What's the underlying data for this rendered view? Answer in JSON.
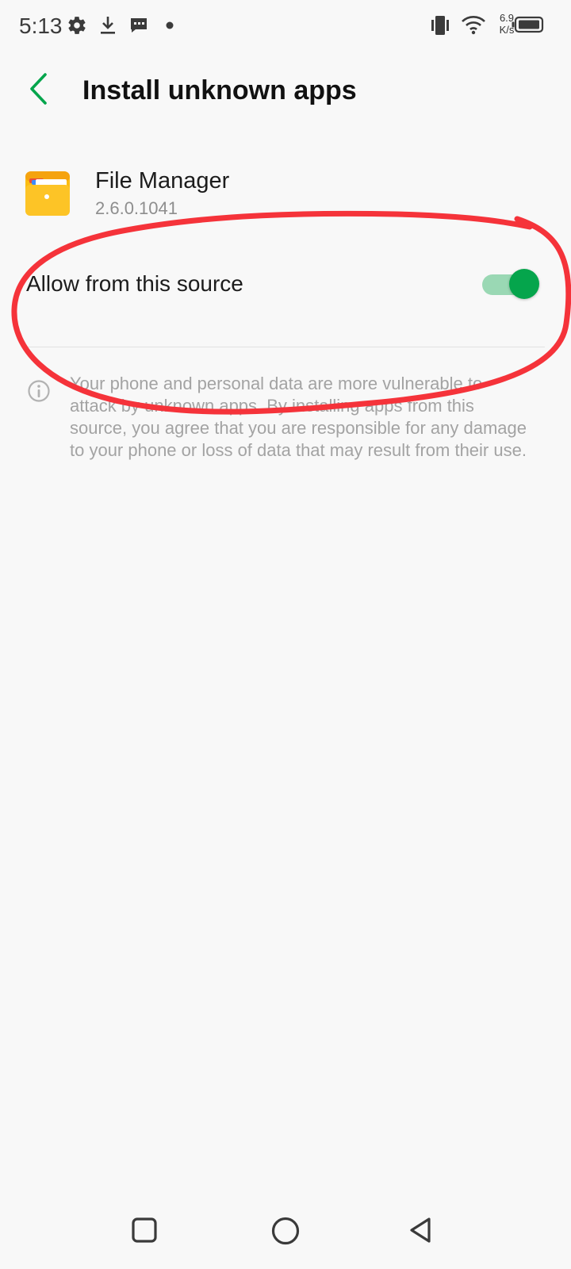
{
  "status_bar": {
    "time": "5:13",
    "net_speed_value": "6.9",
    "net_speed_unit": "K/s",
    "icons": [
      "gear-icon",
      "download-icon",
      "message-icon",
      "dot-icon",
      "vibrate-icon",
      "wifi-icon",
      "battery-icon"
    ]
  },
  "header": {
    "title": "Install unknown apps",
    "back_icon": "chevron-left-icon",
    "accent_color": "#05a54c"
  },
  "app": {
    "name": "File Manager",
    "version": "2.6.0.1041",
    "icon": "folder-icon"
  },
  "setting": {
    "label": "Allow from this source",
    "enabled": true
  },
  "info": {
    "text": "Your phone and personal data are more vulnerable to attack by unknown apps. By installing apps from this source, you agree that you are responsible for any damage to your phone or loss of data that may result from their use.",
    "icon": "info-icon"
  },
  "annotation": {
    "color": "#f5333a"
  },
  "navigation": {
    "icons": [
      "recents-square-icon",
      "home-circle-icon",
      "back-triangle-icon"
    ]
  }
}
